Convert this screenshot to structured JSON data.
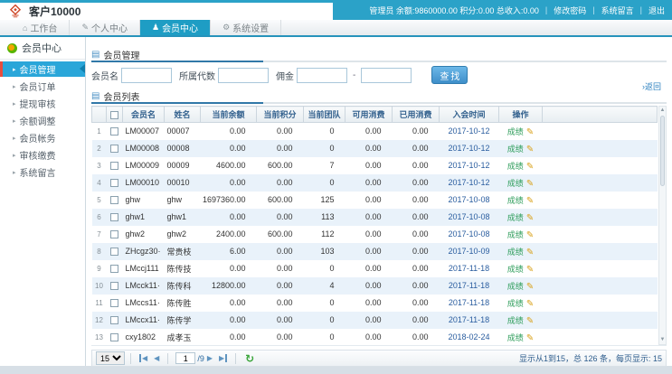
{
  "header": {
    "title": "客户10000",
    "admin_info": "管理员 余额:9860000.00 积分:0.00 总收入:0.00",
    "links": [
      "修改密码",
      "系统留言",
      "退出"
    ]
  },
  "tabs": [
    {
      "label": "工作台",
      "icon": "home-icon",
      "active": false
    },
    {
      "label": "个人中心",
      "icon": "edit-icon",
      "active": false
    },
    {
      "label": "会员中心",
      "icon": "users-icon",
      "active": true
    },
    {
      "label": "系统设置",
      "icon": "gear-icon",
      "active": false
    }
  ],
  "sidebar": {
    "title": "会员中心",
    "items": [
      {
        "label": "会员管理",
        "active": true
      },
      {
        "label": "会员订单",
        "active": false
      },
      {
        "label": "提现审核",
        "active": false
      },
      {
        "label": "余额调整",
        "active": false
      },
      {
        "label": "会员帐务",
        "active": false
      },
      {
        "label": "审核缴费",
        "active": false
      },
      {
        "label": "系统留言",
        "active": false
      }
    ]
  },
  "search_panel": {
    "title": "会员管理",
    "member_label": "会员名",
    "generation_label": "所属代数",
    "commission_label": "佣金",
    "range_separator": "-",
    "search_button": "查找"
  },
  "list_panel": {
    "title": "会员列表",
    "back_link": "返回",
    "columns": [
      "会员名",
      "姓名",
      "当前余额",
      "当前积分",
      "当前团队",
      "可用消费",
      "已用消费",
      "入会时间",
      "操作"
    ],
    "action_label": "成绩",
    "rows": [
      {
        "n": "1",
        "member": "LM00007",
        "name": "00007",
        "balance": "0.00",
        "points": "0.00",
        "team": "0",
        "avail": "0.00",
        "used": "0.00",
        "date": "2017-10-12"
      },
      {
        "n": "2",
        "member": "LM00008",
        "name": "00008",
        "balance": "0.00",
        "points": "0.00",
        "team": "0",
        "avail": "0.00",
        "used": "0.00",
        "date": "2017-10-12"
      },
      {
        "n": "3",
        "member": "LM00009",
        "name": "00009",
        "balance": "4600.00",
        "points": "600.00",
        "team": "7",
        "avail": "0.00",
        "used": "0.00",
        "date": "2017-10-12"
      },
      {
        "n": "4",
        "member": "LM00010",
        "name": "00010",
        "balance": "0.00",
        "points": "0.00",
        "team": "0",
        "avail": "0.00",
        "used": "0.00",
        "date": "2017-10-12"
      },
      {
        "n": "5",
        "member": "ghw",
        "name": "ghw",
        "balance": "1697360.00",
        "points": "600.00",
        "team": "125",
        "avail": "0.00",
        "used": "0.00",
        "date": "2017-10-08"
      },
      {
        "n": "6",
        "member": "ghw1",
        "name": "ghw1",
        "balance": "0.00",
        "points": "0.00",
        "team": "113",
        "avail": "0.00",
        "used": "0.00",
        "date": "2017-10-08"
      },
      {
        "n": "7",
        "member": "ghw2",
        "name": "ghw2",
        "balance": "2400.00",
        "points": "600.00",
        "team": "112",
        "avail": "0.00",
        "used": "0.00",
        "date": "2017-10-08"
      },
      {
        "n": "8",
        "member": "ZHcgz30·",
        "name": "常贵枝",
        "balance": "6.00",
        "points": "0.00",
        "team": "103",
        "avail": "0.00",
        "used": "0.00",
        "date": "2017-10-09"
      },
      {
        "n": "9",
        "member": "LMccj111",
        "name": "陈传技",
        "balance": "0.00",
        "points": "0.00",
        "team": "0",
        "avail": "0.00",
        "used": "0.00",
        "date": "2017-11-18"
      },
      {
        "n": "10",
        "member": "LMcck11·",
        "name": "陈传科",
        "balance": "12800.00",
        "points": "0.00",
        "team": "4",
        "avail": "0.00",
        "used": "0.00",
        "date": "2017-11-18"
      },
      {
        "n": "11",
        "member": "LMccs11·",
        "name": "陈传胜",
        "balance": "0.00",
        "points": "0.00",
        "team": "0",
        "avail": "0.00",
        "used": "0.00",
        "date": "2017-11-18"
      },
      {
        "n": "12",
        "member": "LMccx11·",
        "name": "陈传学",
        "balance": "0.00",
        "points": "0.00",
        "team": "0",
        "avail": "0.00",
        "used": "0.00",
        "date": "2017-11-18"
      },
      {
        "n": "13",
        "member": "cxy1802",
        "name": "成孝玉",
        "balance": "0.00",
        "points": "0.00",
        "team": "0",
        "avail": "0.00",
        "used": "0.00",
        "date": "2018-02-24"
      }
    ]
  },
  "pagination": {
    "page_size": "15",
    "current_page": "1",
    "total_pages": "/9",
    "summary": "显示从1到15，总 126 条，每页显示: 15"
  },
  "colors": {
    "teal_header": "#2ba2c8",
    "active_tab": "#1e9dc4",
    "sidebar_active": "#2aa6d9",
    "red_accent": "#e84c3d",
    "logo_red": "#cf4a2a",
    "link_blue": "#2a7fbf",
    "header_text_blue": "#33618e",
    "date_blue": "#2a5d9f",
    "action_green": "#2e9d5b",
    "pencil_gold": "#d9a21b",
    "row_alt": "#e9f2fa"
  }
}
